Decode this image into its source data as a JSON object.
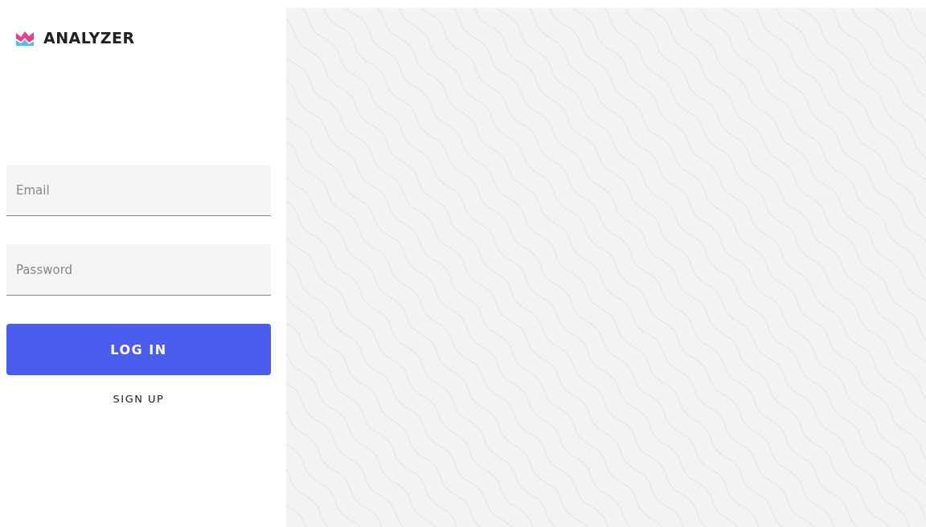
{
  "brand": {
    "name": "ANALYZER"
  },
  "fields": [
    {
      "placeholder": "Email"
    },
    {
      "placeholder": "Password"
    }
  ],
  "buttons": [
    {
      "label": "LOG IN",
      "kind": "primary"
    },
    {
      "label": "SIGN UP",
      "kind": "text"
    }
  ]
}
